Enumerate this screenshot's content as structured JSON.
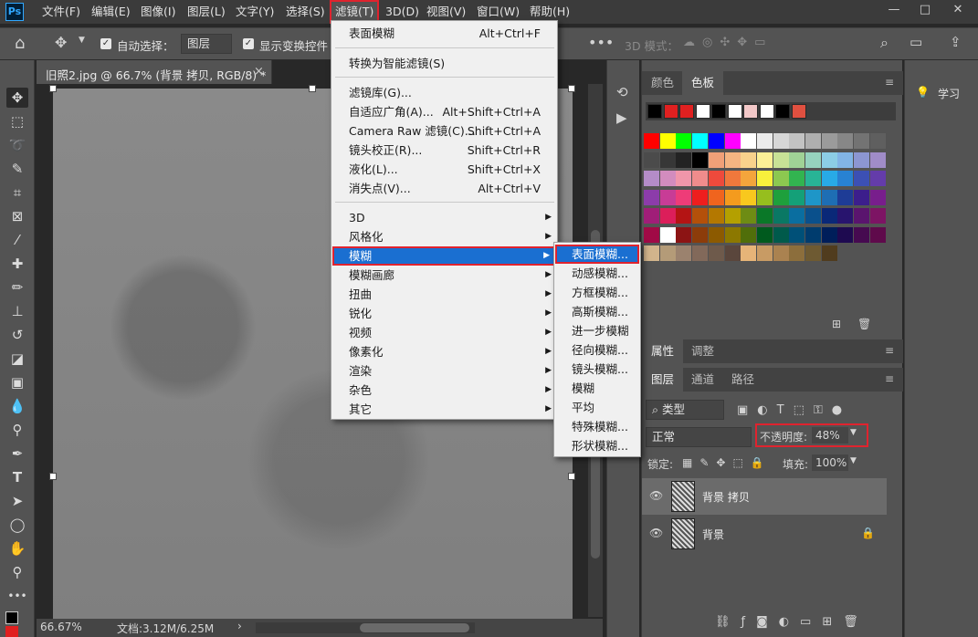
{
  "menubar": {
    "logo": "Ps",
    "items": [
      {
        "label": "文件(F)"
      },
      {
        "label": "编辑(E)"
      },
      {
        "label": "图像(I)"
      },
      {
        "label": "图层(L)"
      },
      {
        "label": "文字(Y)"
      },
      {
        "label": "选择(S)"
      },
      {
        "label": "滤镜(T)"
      },
      {
        "label": "3D(D)"
      },
      {
        "label": "视图(V)"
      },
      {
        "label": "窗口(W)"
      },
      {
        "label": "帮助(H)"
      }
    ],
    "window_controls": [
      "—",
      "□",
      "✕"
    ]
  },
  "options_bar": {
    "auto_select_label": "自动选择：",
    "auto_select_value": "图层",
    "show_transform_label": "显示变换控件",
    "three_d_mode_label": "3D 模式："
  },
  "document": {
    "tab_title": "旧照2.jpg @ 66.7% (背景 拷贝, RGB/8) *",
    "tab_close": "×",
    "zoom": "66.67%",
    "doc_size": "文档:3.12M/6.25M"
  },
  "filter_menu": {
    "items": [
      {
        "label": "表面模糊",
        "shortcut": "Alt+Ctrl+F"
      },
      {
        "label": "转换为智能滤镜(S)",
        "shortcut": ""
      },
      {
        "label": "滤镜库(G)...",
        "shortcut": ""
      },
      {
        "label": "自适应广角(A)...",
        "shortcut": "Alt+Shift+Ctrl+A"
      },
      {
        "label": "Camera Raw 滤镜(C)...",
        "shortcut": "Shift+Ctrl+A"
      },
      {
        "label": "镜头校正(R)...",
        "shortcut": "Shift+Ctrl+R"
      },
      {
        "label": "液化(L)...",
        "shortcut": "Shift+Ctrl+X"
      },
      {
        "label": "消失点(V)...",
        "shortcut": "Alt+Ctrl+V"
      },
      {
        "label": "3D",
        "shortcut": ""
      },
      {
        "label": "风格化",
        "shortcut": ""
      },
      {
        "label": "模糊",
        "shortcut": ""
      },
      {
        "label": "模糊画廊",
        "shortcut": ""
      },
      {
        "label": "扭曲",
        "shortcut": ""
      },
      {
        "label": "锐化",
        "shortcut": ""
      },
      {
        "label": "视频",
        "shortcut": ""
      },
      {
        "label": "像素化",
        "shortcut": ""
      },
      {
        "label": "渲染",
        "shortcut": ""
      },
      {
        "label": "杂色",
        "shortcut": ""
      },
      {
        "label": "其它",
        "shortcut": ""
      }
    ]
  },
  "blur_submenu": {
    "items": [
      "表面模糊...",
      "动感模糊...",
      "方框模糊...",
      "高斯模糊...",
      "进一步模糊",
      "径向模糊...",
      "镜头模糊...",
      "模糊",
      "平均",
      "特殊模糊...",
      "形状模糊..."
    ]
  },
  "swatches_panel": {
    "tabs": [
      "颜色",
      "色板"
    ],
    "recent": [
      "#000000",
      "#e02020",
      "#e02020",
      "#ffffff",
      "#000000",
      "#ffffff",
      "#f2c8c8",
      "#ffffff",
      "#000000",
      "#e05040"
    ],
    "grid": [
      [
        "#ff0000",
        "#ffff00",
        "#00ff00",
        "#00ffff",
        "#0000ff",
        "#ff00ff",
        "#ffffff",
        "#ebebeb",
        "#d7d7d7",
        "#c3c3c3",
        "#afafaf",
        "#9b9b9b",
        "#878787",
        "#737373",
        "#5f5f5f"
      ],
      [
        "#4b4b4b",
        "#373737",
        "#232323",
        "#000000",
        "#f0a078",
        "#f4b482",
        "#f8d28c",
        "#fcf096",
        "#c8e196",
        "#a0d296",
        "#96d2be",
        "#8ccde6",
        "#82b4e6",
        "#8c96d2",
        "#a08cc8"
      ],
      [
        "#b48cc8",
        "#d28cbe",
        "#f096aa",
        "#f08c8c",
        "#ee4a3c",
        "#f0783c",
        "#f4a53c",
        "#f8f03c",
        "#8cc850",
        "#32b450",
        "#28b496",
        "#28aae6",
        "#2882d2",
        "#3c50b4",
        "#643caa"
      ],
      [
        "#8c3caa",
        "#c83c96",
        "#ee3c78",
        "#ee1e1e",
        "#f0641e",
        "#f49b1e",
        "#f8c81e",
        "#96be1e",
        "#1ea03c",
        "#14a078",
        "#1e96c8",
        "#1e6eb4",
        "#1e3c96",
        "#3c1e8c",
        "#781e8c"
      ],
      [
        "#a01e78",
        "#dc1e5a",
        "#b41414",
        "#b4500a",
        "#b47800",
        "#b4a000",
        "#6e8c14",
        "#0a7828",
        "#0a7864",
        "#0a6ea0",
        "#0a508c",
        "#0a2878",
        "#28146e",
        "#5a146e",
        "#7d1464"
      ],
      [
        "#a00a46",
        "#ffffff",
        "#8c1414",
        "#8c3c0a",
        "#8c5a00",
        "#8c7800",
        "#506e0a",
        "#005a1e",
        "#005a4b",
        "#005078",
        "#003c6e",
        "#001e5a",
        "#1e0a50",
        "#460a50",
        "#5f0a4b"
      ],
      [
        "#d2b48c",
        "#b49b78",
        "#9b826e",
        "#82695a",
        "#6e5a4b",
        "#5a463c",
        "#e6b478",
        "#c89b64",
        "#aa8250",
        "#8c6e3c",
        "#6e5a32",
        "#503c1e"
      ]
    ]
  },
  "properties_tabs": [
    "属性",
    "调整"
  ],
  "layers_panel": {
    "tabs": [
      "图层",
      "通道",
      "路径"
    ],
    "filter_kind": "类型",
    "blend_mode": "正常",
    "opacity_label": "不透明度:",
    "opacity_value": "48%",
    "lock_label": "锁定:",
    "fill_label": "填充:",
    "fill_value": "100%",
    "layers": [
      {
        "name": "背景 拷贝",
        "selected": true,
        "locked": false
      },
      {
        "name": "背景",
        "selected": false,
        "locked": true
      }
    ]
  },
  "learn_panel": {
    "label": "学习"
  },
  "colors": {
    "highlight": "#1a6fd1",
    "annotation_red": "#e0232e",
    "foreground": "#e02020"
  }
}
